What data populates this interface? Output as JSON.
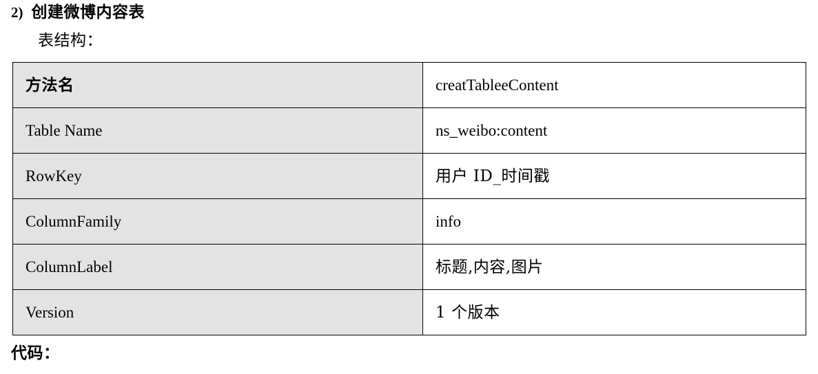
{
  "heading": {
    "marker": "2)",
    "title": "创建微博内容表"
  },
  "subheading": "表结构：",
  "table": {
    "rows": [
      {
        "label": "方法名",
        "value": "creatTableeContent",
        "label_bold": true,
        "value_cjk": false
      },
      {
        "label": "Table Name",
        "value": "ns_weibo:content",
        "label_bold": false,
        "value_cjk": false
      },
      {
        "label": "RowKey",
        "value": "用户 ID_时间戳",
        "label_bold": false,
        "value_cjk": true
      },
      {
        "label": "ColumnFamily",
        "value": "info",
        "label_bold": false,
        "value_cjk": false
      },
      {
        "label": "ColumnLabel",
        "value": "标题,内容,图片",
        "label_bold": false,
        "value_cjk": true
      },
      {
        "label": "Version",
        "value": "1 个版本",
        "label_bold": false,
        "value_cjk": true
      }
    ]
  },
  "footer": {
    "code_label": "代码："
  },
  "colors": {
    "label_cell_background": "#e3e3e3",
    "value_cell_background": "#ffffff",
    "border": "#000000",
    "text": "#000000",
    "page_background": "#ffffff"
  }
}
